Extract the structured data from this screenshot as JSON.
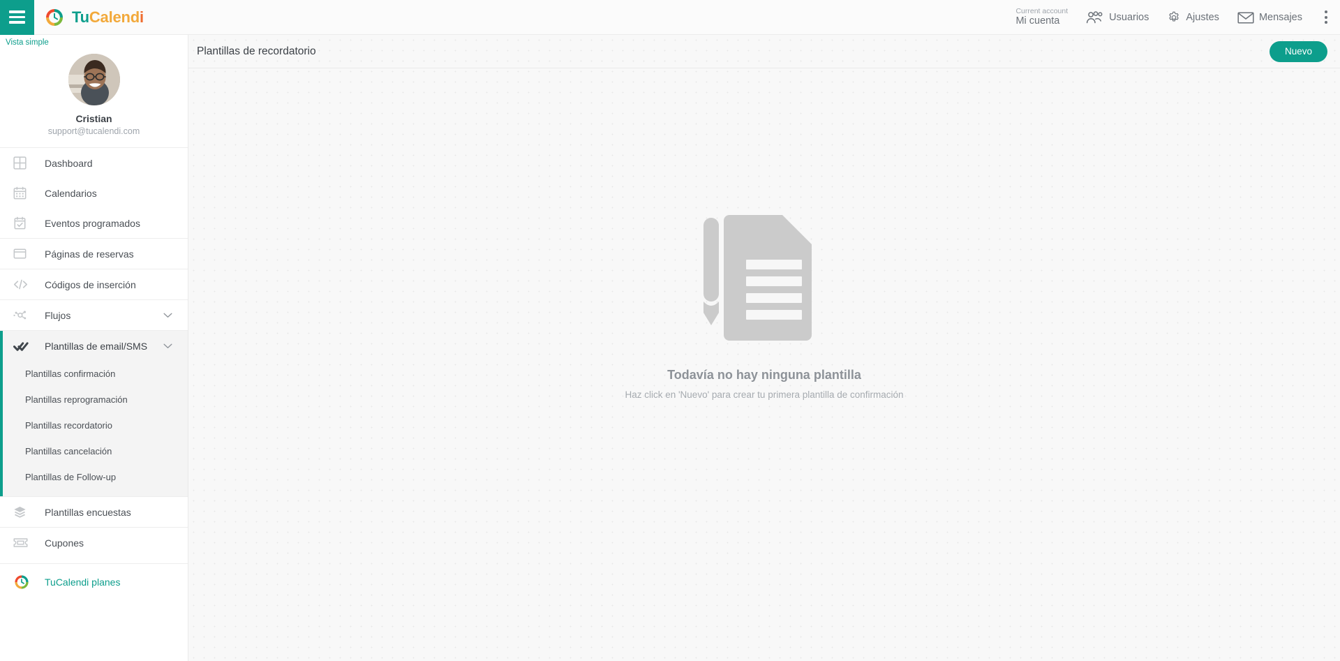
{
  "topbar": {
    "menu_icon": "hamburger-icon",
    "brand": {
      "part1": "Tu",
      "part2": "Calend",
      "part3": "i",
      "logo_icon": "tucalendi-logo-icon",
      "colors": {
        "teal": "#0d9e8c",
        "orange": "#f2a93b",
        "red": "#ef6c2e"
      }
    },
    "account": {
      "label": "Current account",
      "name": "Mi cuenta"
    },
    "items": [
      {
        "label": "Usuarios",
        "icon": "users-icon"
      },
      {
        "label": "Ajustes",
        "icon": "gear-icon"
      },
      {
        "label": "Mensajes",
        "icon": "envelope-icon"
      }
    ],
    "overflow_icon": "kebab-menu-icon"
  },
  "sidebar": {
    "simple_view": "Vista simple",
    "profile": {
      "name": "Cristian",
      "email": "support@tucalendi.com",
      "avatar_icon": "user-avatar"
    },
    "groups": [
      {
        "items": [
          {
            "label": "Dashboard",
            "icon": "dashboard-grid-icon"
          },
          {
            "label": "Calendarios",
            "icon": "calendar-icon"
          },
          {
            "label": "Eventos programados",
            "icon": "calendar-check-icon"
          }
        ]
      },
      {
        "items": [
          {
            "label": "Páginas de reservas",
            "icon": "window-icon"
          }
        ]
      },
      {
        "items": [
          {
            "label": "Códigos de inserción",
            "icon": "code-brackets-icon"
          }
        ]
      },
      {
        "items": [
          {
            "label": "Flujos",
            "icon": "flow-nodes-icon",
            "expandable": true,
            "chevron": "chevron-down-icon"
          }
        ]
      }
    ],
    "active_section": {
      "label": "Plantillas de email/SMS",
      "icon": "double-check-icon",
      "chevron": "chevron-down-icon",
      "submenu": [
        "Plantillas confirmación",
        "Plantillas reprogramación",
        "Plantillas recordatorio",
        "Plantillas cancelación",
        "Plantillas de Follow-up"
      ]
    },
    "bottom_groups": [
      {
        "items": [
          {
            "label": "Plantillas encuestas",
            "icon": "layers-icon"
          }
        ]
      },
      {
        "items": [
          {
            "label": "Cupones",
            "icon": "ticket-icon"
          }
        ]
      }
    ],
    "plans": {
      "label": "TuCalendi planes",
      "icon": "tucalendi-logo-icon"
    }
  },
  "main": {
    "title": "Plantillas de recordatorio",
    "new_button": "Nuevo",
    "empty_state": {
      "illustration": "document-with-pencil-icon",
      "title": "Todavía no hay ninguna plantilla",
      "subtitle": "Haz click en 'Nuevo' para crear tu primera plantilla de confirmación"
    }
  }
}
